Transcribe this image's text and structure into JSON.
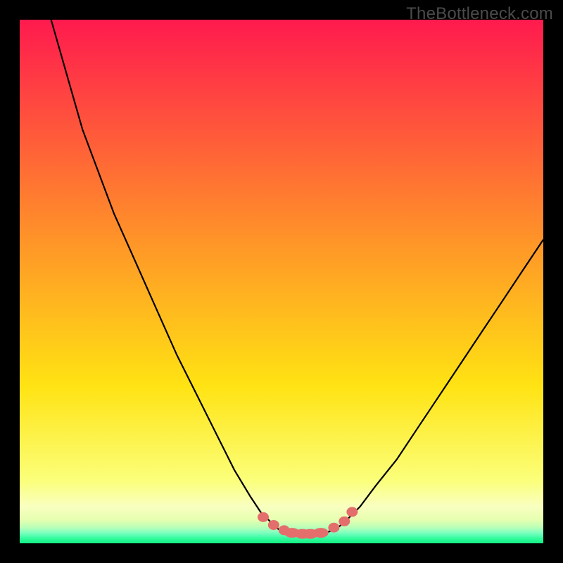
{
  "watermark": "TheBottleneck.com",
  "colors": {
    "frame": "#000000",
    "top": "#ff1a4e",
    "mid": "#ffe313",
    "nearBot": "#f9ffb5",
    "band": "#e6ffb0",
    "green": "#1dfc8a",
    "curve": "#000000",
    "marker": "#e46e6c"
  },
  "chart_data": {
    "type": "line",
    "title": "",
    "xlabel": "",
    "ylabel": "",
    "xlim": [
      0,
      100
    ],
    "ylim": [
      0,
      100
    ],
    "x": [
      6,
      8,
      10,
      12,
      15,
      18,
      22,
      26,
      30,
      34,
      38,
      41,
      44,
      46,
      48,
      49,
      50,
      51,
      52,
      53,
      54,
      55,
      56,
      57,
      58,
      59,
      60,
      61,
      62,
      63,
      65,
      68,
      72,
      76,
      80,
      84,
      88,
      92,
      96,
      100
    ],
    "values": [
      100,
      93,
      86,
      79,
      71,
      63,
      54,
      45,
      36,
      28,
      20,
      14,
      9,
      6,
      4,
      3,
      2.3,
      2,
      1.8,
      1.7,
      1.6,
      1.6,
      1.6,
      1.7,
      1.9,
      2.2,
      2.6,
      3.2,
      4,
      5,
      7,
      11,
      16,
      22,
      28,
      34,
      40,
      46,
      52,
      58
    ],
    "markers_x": [
      46.5,
      48.5,
      50.5,
      52,
      54,
      55.5,
      57.5,
      60,
      62,
      63.5
    ],
    "markers_y": [
      5,
      3.5,
      2.5,
      2,
      1.8,
      1.8,
      2,
      3,
      4.2,
      6
    ]
  }
}
